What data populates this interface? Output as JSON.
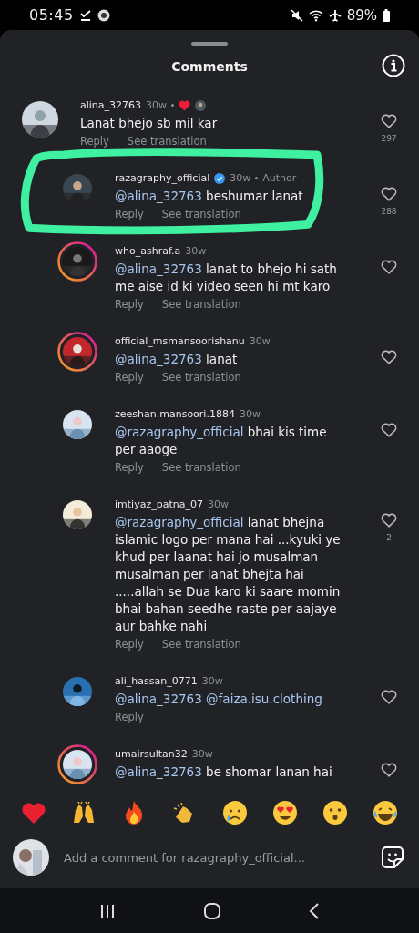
{
  "status_bar": {
    "time": "05:45",
    "battery": "89%"
  },
  "sheet": {
    "title": "Comments"
  },
  "comments": [
    {
      "username": "alina_32763",
      "time": "30w",
      "creator_liked": true,
      "body": [
        {
          "kind": "text",
          "text": "Lanat bhejo sb mil kar"
        }
      ],
      "actions": [
        "Reply",
        "See translation"
      ],
      "likes": "297",
      "children": [
        {
          "username": "razagraphy_official",
          "time": "30w",
          "verified": true,
          "author": "Author",
          "annotated": true,
          "body": [
            {
              "kind": "mention",
              "text": "@alina_32763"
            },
            {
              "kind": "text",
              "text": " beshumar lanat"
            }
          ],
          "actions": [
            "Reply",
            "See translation"
          ],
          "likes": "288"
        },
        {
          "username": "who_ashraf.a",
          "time": "30w",
          "story_ring": true,
          "body": [
            {
              "kind": "mention",
              "text": "@alina_32763"
            },
            {
              "kind": "text",
              "text": " lanat to bhejo hi sath me aise id  ki video seen hi mt karo"
            }
          ],
          "actions": [
            "Reply",
            "See translation"
          ]
        },
        {
          "username": "official_msmansoorishanu",
          "time": "30w",
          "story_ring": true,
          "body": [
            {
              "kind": "mention",
              "text": "@alina_32763"
            },
            {
              "kind": "text",
              "text": " lanat"
            }
          ],
          "actions": [
            "Reply",
            "See translation"
          ]
        },
        {
          "username": "zeeshan.mansoori.1884",
          "time": "30w",
          "body": [
            {
              "kind": "mention",
              "text": "@razagraphy_official"
            },
            {
              "kind": "text",
              "text": " bhai kis time per aaoge"
            }
          ],
          "actions": [
            "Reply",
            "See translation"
          ]
        },
        {
          "username": "imtiyaz_patna_07",
          "time": "30w",
          "body": [
            {
              "kind": "mention",
              "text": "@razagraphy_official"
            },
            {
              "kind": "text",
              "text": " lanat bhejna islamic logo per mana hai ...kyuki ye khud per laanat hai jo musalman musalman per lanat bhejta hai .....allah se Dua karo ki saare momin bhai bahan seedhe raste per aajaye aur bahke nahi"
            }
          ],
          "actions": [
            "Reply",
            "See translation"
          ],
          "likes": "2"
        },
        {
          "username": "ali_hassan_0771",
          "time": "30w",
          "body": [
            {
              "kind": "mention",
              "text": "@alina_32763"
            },
            {
              "kind": "mention",
              "text": " @faiza.isu.clothing"
            }
          ],
          "actions": [
            "Reply"
          ]
        },
        {
          "username": "umairsultan32",
          "time": "30w",
          "story_ring": true,
          "body": [
            {
              "kind": "mention",
              "text": "@alina_32763"
            },
            {
              "kind": "text",
              "text": " be shomar lanan hai"
            }
          ]
        }
      ]
    }
  ],
  "reactions": [
    {
      "kind": "heart"
    },
    {
      "kind": "raised-hands"
    },
    {
      "kind": "fire"
    },
    {
      "kind": "clap"
    },
    {
      "kind": "crying"
    },
    {
      "kind": "heart-eyes"
    },
    {
      "kind": "surprised"
    },
    {
      "kind": "laughing"
    }
  ],
  "composer": {
    "placeholder": "Add a comment for razagraphy_official..."
  }
}
